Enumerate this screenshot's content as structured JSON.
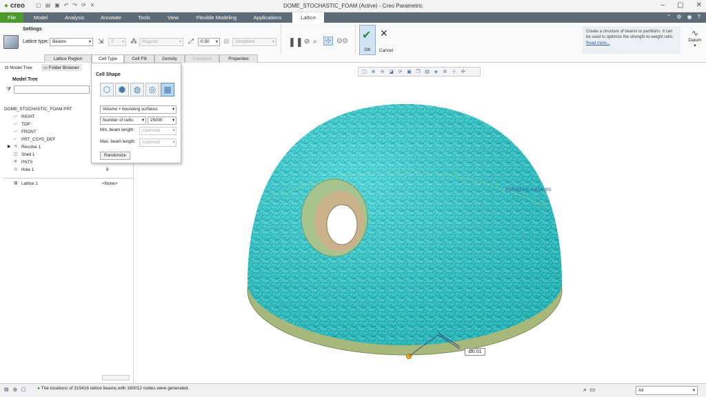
{
  "app": {
    "logo_text": "creo",
    "window_title": "DOME_STOCHASTIC_FOAM (Active) - Creo Parametric"
  },
  "menu": {
    "tabs": [
      "File",
      "Model",
      "Analysis",
      "Annotate",
      "Tools",
      "View",
      "Flexible Modeling",
      "Applications",
      "Lattice"
    ]
  },
  "ribbon": {
    "settings_label": "Settings",
    "lattice_type_label": "Lattice type:",
    "lattice_type_value": "Beams",
    "z_value": "Z",
    "regular_value": "Regular",
    "size_value": "0.50",
    "simplified_value": "Simplified",
    "ok_label": "OK",
    "cancel_label": "Cancel",
    "help_text": "Create a structure of beams or partitions. It can be used to optimize the strength-to-weight ratio.",
    "read_more": "Read more...",
    "datum_label": "Datum",
    "subtabs": [
      "Lattice Region",
      "Cell Type",
      "Cell Fill",
      "Density",
      "Transition",
      "Properties"
    ]
  },
  "left_panel": {
    "tabs": [
      "Model Tree",
      "Folder Browser"
    ],
    "title": "Model Tree",
    "items": [
      {
        "name": "DOME_STOCHASTIC_FOAM.PRT",
        "icon": "part-icon",
        "value": ""
      },
      {
        "name": "RIGHT",
        "icon": "datum-plane-icon",
        "value": ""
      },
      {
        "name": "TOP",
        "icon": "datum-plane-icon",
        "value": ""
      },
      {
        "name": "FRONT",
        "icon": "datum-plane-icon",
        "value": ""
      },
      {
        "name": "PRT_CSYS_DEF",
        "icon": "csys-icon",
        "value": ""
      },
      {
        "name": "Revolve 1",
        "icon": "revolve-icon",
        "value": ""
      },
      {
        "name": "Shell 1",
        "icon": "shell-icon",
        "value": ""
      },
      {
        "name": "PNT0",
        "icon": "point-icon",
        "value": ""
      },
      {
        "name": "Hole 1",
        "icon": "hole-icon",
        "value": "8"
      }
    ],
    "lattice_item": {
      "name": "Lattice 1",
      "value": "<None>"
    }
  },
  "cell_panel": {
    "title": "Cell Shape",
    "boundary_value": "Volume + bounding surfaces",
    "cells_mode": "Number of cells:",
    "cells_value": "25000",
    "min_beam_label": "Min. beam length:",
    "max_beam_label": "Max. beam length:",
    "optional_placeholder": "(optional)",
    "randomize_label": "Randomize"
  },
  "viewport": {
    "annotation": "Individual surfaces",
    "dimension_tag": "Ø0.01"
  },
  "status": {
    "message": "The locations of 315416 lattice beams with 160012 nodes were generated.",
    "filter_value": "All"
  }
}
